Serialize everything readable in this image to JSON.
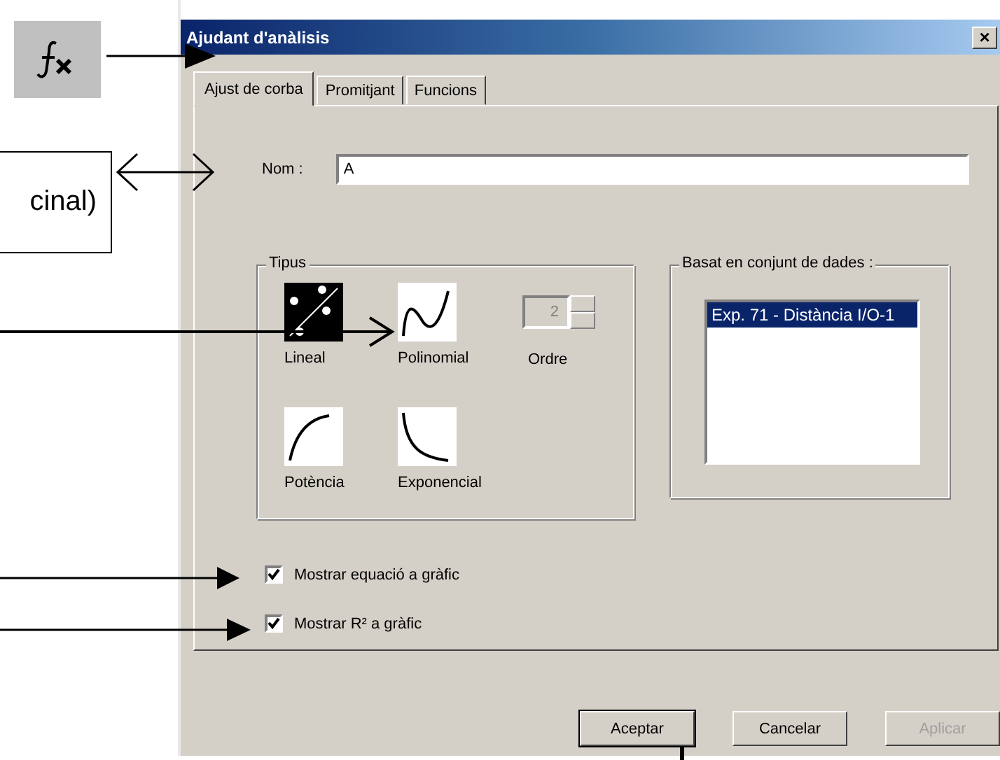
{
  "window": {
    "title": "Ajudant d'anàlisis",
    "close": "×"
  },
  "tabs": [
    {
      "label": "Ajust de corba",
      "selected": true
    },
    {
      "label": "Promitjant",
      "selected": false
    },
    {
      "label": "Funcions",
      "selected": false
    }
  ],
  "name_field": {
    "label": "Nom :",
    "value": "A"
  },
  "type_group": {
    "title": "Tipus",
    "types": [
      {
        "kind": "linear",
        "label": "Lineal",
        "selected": true
      },
      {
        "kind": "polynomial",
        "label": "Polinomial",
        "selected": false
      },
      {
        "kind": "power",
        "label": "Potència",
        "selected": false
      },
      {
        "kind": "exponential",
        "label": "Exponencial",
        "selected": false
      }
    ],
    "order": {
      "label": "Ordre",
      "value": "2",
      "disabled": true
    }
  },
  "dataset_group": {
    "title": "Basat en conjunt de dades :",
    "items": [
      {
        "label": "Exp. 71 - Distància I/O-1",
        "selected": true
      }
    ]
  },
  "options": [
    {
      "label": "Mostrar equació a gràfic",
      "checked": true
    },
    {
      "label": "Mostrar R² a gràfic",
      "checked": true
    }
  ],
  "buttons": [
    {
      "label": "Aceptar",
      "default": true,
      "disabled": false
    },
    {
      "label": "Cancelar",
      "default": false,
      "disabled": false
    },
    {
      "label": "Aplicar",
      "default": false,
      "disabled": true
    }
  ],
  "annotations": {
    "callout": "cinal)"
  }
}
